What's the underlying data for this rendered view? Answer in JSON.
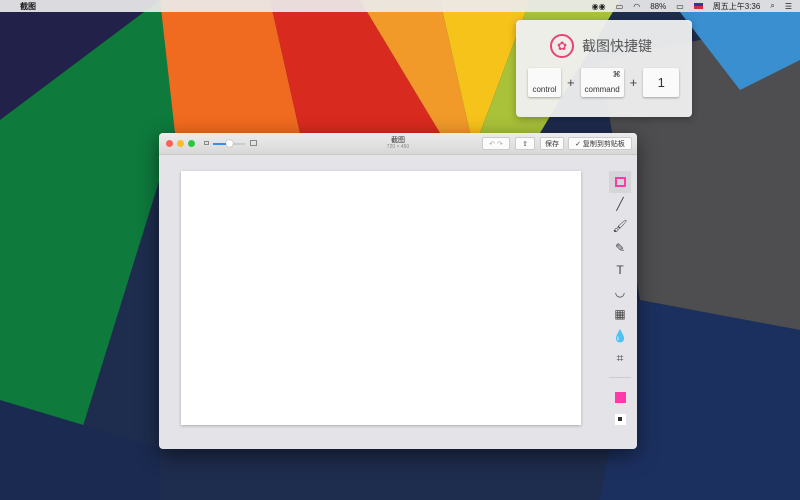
{
  "menubar": {
    "app_name": "截图",
    "battery": "88%",
    "clock": "周五上午3:36"
  },
  "popup": {
    "title": "截图快捷键",
    "keys": [
      {
        "label": "control"
      },
      {
        "label": "command",
        "symbol": "⌘"
      },
      {
        "label": "1"
      }
    ],
    "plus": "+"
  },
  "window": {
    "title": "截图",
    "subtitle": "720 × 450",
    "save_label": "保存",
    "copy_label": "复制到剪贴板"
  },
  "tools": [
    "rectangle-icon",
    "line-icon",
    "brush-icon",
    "pencil-icon",
    "text-icon",
    "emoji-icon",
    "mosaic-icon",
    "blur-drop-icon",
    "crop-icon"
  ],
  "colors": {
    "accent": "#ff3aa8",
    "selected_color": "#ff3aa8"
  }
}
